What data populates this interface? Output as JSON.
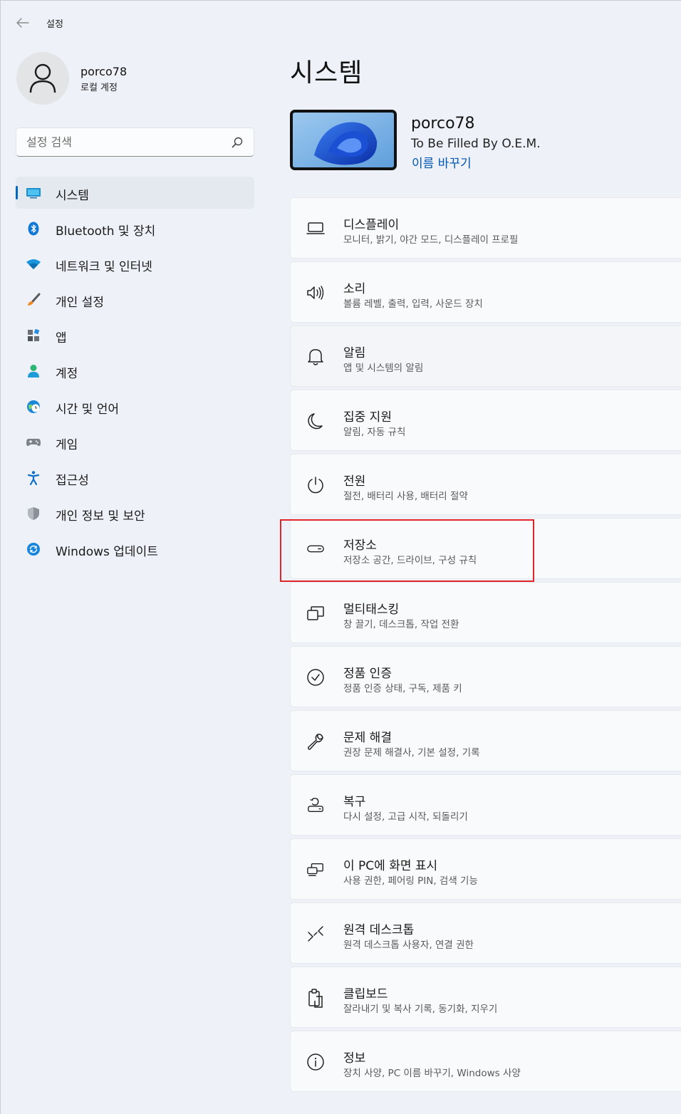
{
  "window": {
    "title": "설정"
  },
  "profile": {
    "name": "porco78",
    "account_type": "로컬 계정"
  },
  "search": {
    "placeholder": "설정 검색",
    "value": ""
  },
  "sidebar": {
    "items": [
      {
        "label": "시스템",
        "icon": "system-icon",
        "active": true
      },
      {
        "label": "Bluetooth 및 장치",
        "icon": "bluetooth-icon"
      },
      {
        "label": "네트워크 및 인터넷",
        "icon": "wifi-icon"
      },
      {
        "label": "개인 설정",
        "icon": "brush-icon"
      },
      {
        "label": "앱",
        "icon": "apps-icon"
      },
      {
        "label": "계정",
        "icon": "account-icon"
      },
      {
        "label": "시간 및 언어",
        "icon": "time-language-icon"
      },
      {
        "label": "게임",
        "icon": "gaming-icon"
      },
      {
        "label": "접근성",
        "icon": "accessibility-icon"
      },
      {
        "label": "개인 정보 및 보안",
        "icon": "shield-icon"
      },
      {
        "label": "Windows 업데이트",
        "icon": "update-icon"
      }
    ]
  },
  "main": {
    "title": "시스템",
    "device": {
      "name": "porco78",
      "model": "To Be Filled By O.E.M.",
      "rename_label": "이름 바꾸기"
    },
    "cards": [
      {
        "title": "디스플레이",
        "subtitle": "모니터, 밝기, 야간 모드, 디스플레이 프로필",
        "icon": "display-icon"
      },
      {
        "title": "소리",
        "subtitle": "볼륨 레벨, 출력, 입력, 사운드 장치",
        "icon": "sound-icon"
      },
      {
        "title": "알림",
        "subtitle": "앱 및 시스템의 알림",
        "icon": "bell-icon"
      },
      {
        "title": "집중 지원",
        "subtitle": "알림, 자동 규칙",
        "icon": "moon-icon"
      },
      {
        "title": "전원",
        "subtitle": "절전, 배터리 사용, 배터리 절약",
        "icon": "power-icon"
      },
      {
        "title": "저장소",
        "subtitle": "저장소 공간, 드라이브, 구성 규칙",
        "icon": "storage-icon"
      },
      {
        "title": "멀티태스킹",
        "subtitle": "창 끌기, 데스크톱, 작업 전환",
        "icon": "multitasking-icon"
      },
      {
        "title": "정품 인증",
        "subtitle": "정품 인증 상태, 구독, 제품 키",
        "icon": "activation-icon"
      },
      {
        "title": "문제 해결",
        "subtitle": "권장 문제 해결사, 기본 설정, 기록",
        "icon": "wrench-icon"
      },
      {
        "title": "복구",
        "subtitle": "다시 설정, 고급 시작, 되돌리기",
        "icon": "recovery-icon"
      },
      {
        "title": "이 PC에 화면 표시",
        "subtitle": "사용 권한, 페어링 PIN, 검색 기능",
        "icon": "projecting-icon"
      },
      {
        "title": "원격 데스크톱",
        "subtitle": "원격 데스크톱 사용자, 연결 권한",
        "icon": "remote-desktop-icon"
      },
      {
        "title": "클립보드",
        "subtitle": "잘라내기 및 복사 기록, 동기화, 지우기",
        "icon": "clipboard-icon"
      },
      {
        "title": "정보",
        "subtitle": "장치 사양, PC 이름 바꾸기, Windows 사양",
        "icon": "info-icon"
      }
    ]
  },
  "colors": {
    "accent": "#0067c0",
    "highlight": "#e0242a"
  }
}
